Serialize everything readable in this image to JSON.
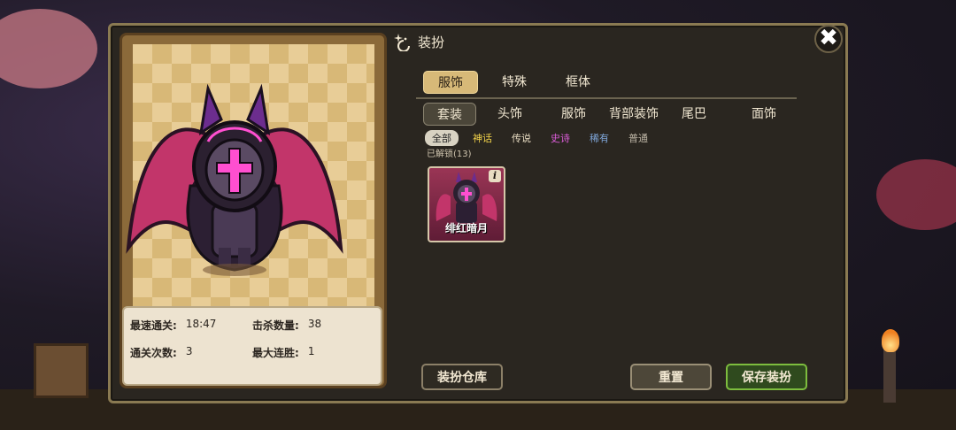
{
  "panel": {
    "title": "装扮",
    "close_label": "✖"
  },
  "tabs_main": [
    {
      "label": "服饰",
      "active": true
    },
    {
      "label": "特殊",
      "active": false
    },
    {
      "label": "框体",
      "active": false
    }
  ],
  "tabs_sub": [
    {
      "label": "套装",
      "active": true
    },
    {
      "label": "头饰",
      "active": false
    },
    {
      "label": "服饰",
      "active": false
    },
    {
      "label": "背部装饰",
      "active": false
    },
    {
      "label": "尾巴",
      "active": false
    },
    {
      "label": "面饰",
      "active": false
    }
  ],
  "rarity_filters": [
    {
      "label": "全部",
      "color": "#222222",
      "active": true
    },
    {
      "label": "神话",
      "color": "#f3d34a",
      "active": false
    },
    {
      "label": "传说",
      "color": "#e8dcc2",
      "active": false
    },
    {
      "label": "史诗",
      "color": "#d95cd6",
      "active": false
    },
    {
      "label": "稀有",
      "color": "#7fa6d9",
      "active": false
    },
    {
      "label": "普通",
      "color": "#bdb5a5",
      "active": false
    }
  ],
  "unlocked_text": "已解锁(13)",
  "items": [
    {
      "name": "绯红暗月",
      "info_icon": "i"
    }
  ],
  "stats": {
    "fastest_label": "最速通关:",
    "fastest_value": "18:47",
    "kills_label": "击杀数量:",
    "kills_value": "38",
    "clears_label": "通关次数:",
    "clears_value": "3",
    "streak_label": "最大连胜:",
    "streak_value": "1"
  },
  "buttons": {
    "wardrobe": "装扮仓库",
    "reset": "重置",
    "save": "保存装扮"
  },
  "colors": {
    "accent_gold": "#d7b978",
    "save_green": "#7dbd3e",
    "item_bg": "#9a3555"
  }
}
